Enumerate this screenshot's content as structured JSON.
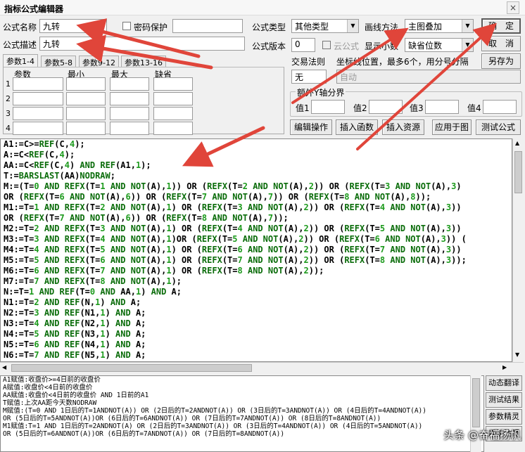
{
  "window": {
    "title": "指标公式编辑器",
    "close": "×"
  },
  "form": {
    "name_label": "公式名称",
    "name_value": "九转",
    "password_label": "密码保护",
    "desc_label": "公式描述",
    "desc_value": "九转",
    "type_label": "公式类型",
    "type_value": "其他类型",
    "draw_label": "画线方法",
    "draw_value": "主图叠加",
    "version_label": "公式版本",
    "version_value": "0",
    "cloud_label": "云公式",
    "decimal_label": "显示小数",
    "decimal_value": "缺省位数"
  },
  "buttons": {
    "ok": "确　定",
    "cancel": "取　消",
    "save_as": "另存为",
    "edit": "编辑操作",
    "insert_func": "插入函数",
    "insert_res": "插入资源",
    "apply": "应用于图",
    "test": "测试公式"
  },
  "params": {
    "tabs": [
      "参数1-4",
      "参数5-8",
      "参数9-12",
      "参数13-16"
    ],
    "headers": [
      "参数",
      "最小",
      "最大",
      "缺省"
    ],
    "rows": [
      "1",
      "2",
      "3",
      "4"
    ]
  },
  "trade": {
    "rule_label": "交易法则",
    "rule_value": "无",
    "coord_label": "坐标线位置，最多6个，用分号分隔",
    "coord_value": "自动"
  },
  "extra_y": {
    "title": "额外Y轴分界",
    "labels": [
      "值1",
      "值2",
      "值3",
      "值4"
    ]
  },
  "code_lines": [
    [
      [
        "t",
        "A1:=C>="
      ],
      [
        "k",
        "REF"
      ],
      [
        "t",
        "(C,"
      ],
      [
        "n",
        "4"
      ],
      [
        "t",
        ");"
      ]
    ],
    [
      [
        "t",
        "A:=C<"
      ],
      [
        "k",
        "REF"
      ],
      [
        "t",
        "(C,"
      ],
      [
        "n",
        "4"
      ],
      [
        "t",
        ");"
      ]
    ],
    [
      [
        "t",
        "AA:=C<"
      ],
      [
        "k",
        "REF"
      ],
      [
        "t",
        "(C,"
      ],
      [
        "n",
        "4"
      ],
      [
        "t",
        ") "
      ],
      [
        "k",
        "AND"
      ],
      [
        "t",
        " "
      ],
      [
        "k",
        "REF"
      ],
      [
        "t",
        "(A1,"
      ],
      [
        "n",
        "1"
      ],
      [
        "t",
        ");"
      ]
    ],
    [
      [
        "t",
        "T:="
      ],
      [
        "k",
        "BARSLAST"
      ],
      [
        "t",
        "(AA)"
      ],
      [
        "k",
        "NODRAW"
      ],
      [
        "t",
        ";"
      ]
    ],
    [
      [
        "t",
        "M:=(T="
      ],
      [
        "n",
        "0"
      ],
      [
        "t",
        " "
      ],
      [
        "k",
        "AND"
      ],
      [
        "t",
        " "
      ],
      [
        "k",
        "REFX"
      ],
      [
        "t",
        "(T="
      ],
      [
        "n",
        "1"
      ],
      [
        "t",
        " "
      ],
      [
        "k",
        "AND"
      ],
      [
        "t",
        " "
      ],
      [
        "k",
        "NOT"
      ],
      [
        "t",
        "(A),"
      ],
      [
        "n",
        "1"
      ],
      [
        "t",
        ")) OR ("
      ],
      [
        "k",
        "REFX"
      ],
      [
        "t",
        "(T="
      ],
      [
        "n",
        "2"
      ],
      [
        "t",
        " "
      ],
      [
        "k",
        "AND"
      ],
      [
        "t",
        " "
      ],
      [
        "k",
        "NOT"
      ],
      [
        "t",
        "(A),"
      ],
      [
        "n",
        "2"
      ],
      [
        "t",
        ")) OR ("
      ],
      [
        "k",
        "REFX"
      ],
      [
        "t",
        "(T="
      ],
      [
        "n",
        "3"
      ],
      [
        "t",
        " "
      ],
      [
        "k",
        "AND"
      ],
      [
        "t",
        " "
      ],
      [
        "k",
        "NOT"
      ],
      [
        "t",
        "(A),"
      ],
      [
        "n",
        "3"
      ],
      [
        "t",
        ")"
      ]
    ],
    [
      [
        "t",
        "OR ("
      ],
      [
        "k",
        "REFX"
      ],
      [
        "t",
        "(T="
      ],
      [
        "n",
        "6"
      ],
      [
        "t",
        " "
      ],
      [
        "k",
        "AND"
      ],
      [
        "t",
        " "
      ],
      [
        "k",
        "NOT"
      ],
      [
        "t",
        "(A),"
      ],
      [
        "n",
        "6"
      ],
      [
        "t",
        ")) OR ("
      ],
      [
        "k",
        "REFX"
      ],
      [
        "t",
        "(T="
      ],
      [
        "n",
        "7"
      ],
      [
        "t",
        " "
      ],
      [
        "k",
        "AND"
      ],
      [
        "t",
        " "
      ],
      [
        "k",
        "NOT"
      ],
      [
        "t",
        "(A),"
      ],
      [
        "n",
        "7"
      ],
      [
        "t",
        ")) OR ("
      ],
      [
        "k",
        "REFX"
      ],
      [
        "t",
        "(T="
      ],
      [
        "n",
        "8"
      ],
      [
        "t",
        " "
      ],
      [
        "k",
        "AND"
      ],
      [
        "t",
        " "
      ],
      [
        "k",
        "NOT"
      ],
      [
        "t",
        "(A),"
      ],
      [
        "n",
        "8"
      ],
      [
        "t",
        "));"
      ]
    ],
    [
      [
        "t",
        "M1:=T="
      ],
      [
        "n",
        "1"
      ],
      [
        "t",
        " "
      ],
      [
        "k",
        "AND"
      ],
      [
        "t",
        " "
      ],
      [
        "k",
        "REFX"
      ],
      [
        "t",
        "(T="
      ],
      [
        "n",
        "2"
      ],
      [
        "t",
        " "
      ],
      [
        "k",
        "AND"
      ],
      [
        "t",
        " "
      ],
      [
        "k",
        "NOT"
      ],
      [
        "t",
        "(A),"
      ],
      [
        "n",
        "1"
      ],
      [
        "t",
        ") OR ("
      ],
      [
        "k",
        "REFX"
      ],
      [
        "t",
        "(T="
      ],
      [
        "n",
        "3"
      ],
      [
        "t",
        " "
      ],
      [
        "k",
        "AND"
      ],
      [
        "t",
        " "
      ],
      [
        "k",
        "NOT"
      ],
      [
        "t",
        "(A),"
      ],
      [
        "n",
        "2"
      ],
      [
        "t",
        ")) OR ("
      ],
      [
        "k",
        "REFX"
      ],
      [
        "t",
        "(T="
      ],
      [
        "n",
        "4"
      ],
      [
        "t",
        " "
      ],
      [
        "k",
        "AND"
      ],
      [
        "t",
        " "
      ],
      [
        "k",
        "NOT"
      ],
      [
        "t",
        "(A),"
      ],
      [
        "n",
        "3"
      ],
      [
        "t",
        "))"
      ]
    ],
    [
      [
        "t",
        "OR ("
      ],
      [
        "k",
        "REFX"
      ],
      [
        "t",
        "(T="
      ],
      [
        "n",
        "7"
      ],
      [
        "t",
        " "
      ],
      [
        "k",
        "AND"
      ],
      [
        "t",
        " "
      ],
      [
        "k",
        "NOT"
      ],
      [
        "t",
        "(A),"
      ],
      [
        "n",
        "6"
      ],
      [
        "t",
        ")) OR ("
      ],
      [
        "k",
        "REFX"
      ],
      [
        "t",
        "(T="
      ],
      [
        "n",
        "8"
      ],
      [
        "t",
        " "
      ],
      [
        "k",
        "AND"
      ],
      [
        "t",
        " "
      ],
      [
        "k",
        "NOT"
      ],
      [
        "t",
        "(A),"
      ],
      [
        "n",
        "7"
      ],
      [
        "t",
        "));"
      ]
    ],
    [
      [
        "t",
        "M2:=T="
      ],
      [
        "n",
        "2"
      ],
      [
        "t",
        " "
      ],
      [
        "k",
        "AND"
      ],
      [
        "t",
        " "
      ],
      [
        "k",
        "REFX"
      ],
      [
        "t",
        "(T="
      ],
      [
        "n",
        "3"
      ],
      [
        "t",
        " "
      ],
      [
        "k",
        "AND"
      ],
      [
        "t",
        " "
      ],
      [
        "k",
        "NOT"
      ],
      [
        "t",
        "(A),"
      ],
      [
        "n",
        "1"
      ],
      [
        "t",
        ") OR ("
      ],
      [
        "k",
        "REFX"
      ],
      [
        "t",
        "(T="
      ],
      [
        "n",
        "4"
      ],
      [
        "t",
        " "
      ],
      [
        "k",
        "AND"
      ],
      [
        "t",
        " "
      ],
      [
        "k",
        "NOT"
      ],
      [
        "t",
        "(A),"
      ],
      [
        "n",
        "2"
      ],
      [
        "t",
        ")) OR ("
      ],
      [
        "k",
        "REFX"
      ],
      [
        "t",
        "(T="
      ],
      [
        "n",
        "5"
      ],
      [
        "t",
        " "
      ],
      [
        "k",
        "AND"
      ],
      [
        "t",
        " "
      ],
      [
        "k",
        "NOT"
      ],
      [
        "t",
        "(A),"
      ],
      [
        "n",
        "3"
      ],
      [
        "t",
        "))"
      ]
    ],
    [
      [
        "t",
        "M3:=T="
      ],
      [
        "n",
        "3"
      ],
      [
        "t",
        " "
      ],
      [
        "k",
        "AND"
      ],
      [
        "t",
        " "
      ],
      [
        "k",
        "REFX"
      ],
      [
        "t",
        "(T="
      ],
      [
        "n",
        "4"
      ],
      [
        "t",
        " "
      ],
      [
        "k",
        "AND"
      ],
      [
        "t",
        " "
      ],
      [
        "k",
        "NOT"
      ],
      [
        "t",
        "(A),"
      ],
      [
        "n",
        "1"
      ],
      [
        "t",
        ")OR ("
      ],
      [
        "k",
        "REFX"
      ],
      [
        "t",
        "(T="
      ],
      [
        "n",
        "5"
      ],
      [
        "t",
        " "
      ],
      [
        "k",
        "AND"
      ],
      [
        "t",
        " "
      ],
      [
        "k",
        "NOT"
      ],
      [
        "t",
        "(A),"
      ],
      [
        "n",
        "2"
      ],
      [
        "t",
        ")) OR ("
      ],
      [
        "k",
        "REFX"
      ],
      [
        "t",
        "(T="
      ],
      [
        "n",
        "6"
      ],
      [
        "t",
        " "
      ],
      [
        "k",
        "AND"
      ],
      [
        "t",
        " "
      ],
      [
        "k",
        "NOT"
      ],
      [
        "t",
        "(A),"
      ],
      [
        "n",
        "3"
      ],
      [
        "t",
        ")) ("
      ]
    ],
    [
      [
        "t",
        "M4:=T="
      ],
      [
        "n",
        "4"
      ],
      [
        "t",
        " "
      ],
      [
        "k",
        "AND"
      ],
      [
        "t",
        " "
      ],
      [
        "k",
        "REFX"
      ],
      [
        "t",
        "(T="
      ],
      [
        "n",
        "5"
      ],
      [
        "t",
        " "
      ],
      [
        "k",
        "AND"
      ],
      [
        "t",
        " "
      ],
      [
        "k",
        "NOT"
      ],
      [
        "t",
        "(A),"
      ],
      [
        "n",
        "1"
      ],
      [
        "t",
        ") OR ("
      ],
      [
        "k",
        "REFX"
      ],
      [
        "t",
        "(T="
      ],
      [
        "n",
        "6"
      ],
      [
        "t",
        " "
      ],
      [
        "k",
        "AND"
      ],
      [
        "t",
        " "
      ],
      [
        "k",
        "NOT"
      ],
      [
        "t",
        "(A),"
      ],
      [
        "n",
        "2"
      ],
      [
        "t",
        ")) OR ("
      ],
      [
        "k",
        "REFX"
      ],
      [
        "t",
        "(T="
      ],
      [
        "n",
        "7"
      ],
      [
        "t",
        " "
      ],
      [
        "k",
        "AND"
      ],
      [
        "t",
        " "
      ],
      [
        "k",
        "NOT"
      ],
      [
        "t",
        "(A),"
      ],
      [
        "n",
        "3"
      ],
      [
        "t",
        "))"
      ]
    ],
    [
      [
        "t",
        "M5:=T="
      ],
      [
        "n",
        "5"
      ],
      [
        "t",
        " "
      ],
      [
        "k",
        "AND"
      ],
      [
        "t",
        " "
      ],
      [
        "k",
        "REFX"
      ],
      [
        "t",
        "(T="
      ],
      [
        "n",
        "6"
      ],
      [
        "t",
        " "
      ],
      [
        "k",
        "AND"
      ],
      [
        "t",
        " "
      ],
      [
        "k",
        "NOT"
      ],
      [
        "t",
        "(A),"
      ],
      [
        "n",
        "1"
      ],
      [
        "t",
        ") OR ("
      ],
      [
        "k",
        "REFX"
      ],
      [
        "t",
        "(T="
      ],
      [
        "n",
        "7"
      ],
      [
        "t",
        " "
      ],
      [
        "k",
        "AND"
      ],
      [
        "t",
        " "
      ],
      [
        "k",
        "NOT"
      ],
      [
        "t",
        "(A),"
      ],
      [
        "n",
        "2"
      ],
      [
        "t",
        ")) OR ("
      ],
      [
        "k",
        "REFX"
      ],
      [
        "t",
        "(T="
      ],
      [
        "n",
        "8"
      ],
      [
        "t",
        " "
      ],
      [
        "k",
        "AND"
      ],
      [
        "t",
        " "
      ],
      [
        "k",
        "NOT"
      ],
      [
        "t",
        "(A),"
      ],
      [
        "n",
        "3"
      ],
      [
        "t",
        "));"
      ]
    ],
    [
      [
        "t",
        "M6:=T="
      ],
      [
        "n",
        "6"
      ],
      [
        "t",
        " "
      ],
      [
        "k",
        "AND"
      ],
      [
        "t",
        " "
      ],
      [
        "k",
        "REFX"
      ],
      [
        "t",
        "(T="
      ],
      [
        "n",
        "7"
      ],
      [
        "t",
        " "
      ],
      [
        "k",
        "AND"
      ],
      [
        "t",
        " "
      ],
      [
        "k",
        "NOT"
      ],
      [
        "t",
        "(A),"
      ],
      [
        "n",
        "1"
      ],
      [
        "t",
        ") OR ("
      ],
      [
        "k",
        "REFX"
      ],
      [
        "t",
        "(T="
      ],
      [
        "n",
        "8"
      ],
      [
        "t",
        " "
      ],
      [
        "k",
        "AND"
      ],
      [
        "t",
        " "
      ],
      [
        "k",
        "NOT"
      ],
      [
        "t",
        "(A),"
      ],
      [
        "n",
        "2"
      ],
      [
        "t",
        "));"
      ]
    ],
    [
      [
        "t",
        "M7:=T="
      ],
      [
        "n",
        "7"
      ],
      [
        "t",
        " "
      ],
      [
        "k",
        "AND"
      ],
      [
        "t",
        " "
      ],
      [
        "k",
        "REFX"
      ],
      [
        "t",
        "(T="
      ],
      [
        "n",
        "8"
      ],
      [
        "t",
        " "
      ],
      [
        "k",
        "AND"
      ],
      [
        "t",
        " "
      ],
      [
        "k",
        "NOT"
      ],
      [
        "t",
        "(A),"
      ],
      [
        "n",
        "1"
      ],
      [
        "t",
        ");"
      ]
    ],
    [
      [
        "t",
        "N:=T="
      ],
      [
        "n",
        "1"
      ],
      [
        "t",
        " "
      ],
      [
        "k",
        "AND"
      ],
      [
        "t",
        " "
      ],
      [
        "k",
        "REF"
      ],
      [
        "t",
        "(T="
      ],
      [
        "n",
        "0"
      ],
      [
        "t",
        " "
      ],
      [
        "k",
        "AND"
      ],
      [
        "t",
        " AA,"
      ],
      [
        "n",
        "1"
      ],
      [
        "t",
        ") "
      ],
      [
        "k",
        "AND"
      ],
      [
        "t",
        " A;"
      ]
    ],
    [
      [
        "t",
        "N1:=T="
      ],
      [
        "n",
        "2"
      ],
      [
        "t",
        " "
      ],
      [
        "k",
        "AND"
      ],
      [
        "t",
        " "
      ],
      [
        "k",
        "REF"
      ],
      [
        "t",
        "(N,"
      ],
      [
        "n",
        "1"
      ],
      [
        "t",
        ") "
      ],
      [
        "k",
        "AND"
      ],
      [
        "t",
        " A;"
      ]
    ],
    [
      [
        "t",
        "N2:=T="
      ],
      [
        "n",
        "3"
      ],
      [
        "t",
        " "
      ],
      [
        "k",
        "AND"
      ],
      [
        "t",
        " "
      ],
      [
        "k",
        "REF"
      ],
      [
        "t",
        "(N1,"
      ],
      [
        "n",
        "1"
      ],
      [
        "t",
        ") "
      ],
      [
        "k",
        "AND"
      ],
      [
        "t",
        " A;"
      ]
    ],
    [
      [
        "t",
        "N3:=T="
      ],
      [
        "n",
        "4"
      ],
      [
        "t",
        " "
      ],
      [
        "k",
        "AND"
      ],
      [
        "t",
        " "
      ],
      [
        "k",
        "REF"
      ],
      [
        "t",
        "(N2,"
      ],
      [
        "n",
        "1"
      ],
      [
        "t",
        ") "
      ],
      [
        "k",
        "AND"
      ],
      [
        "t",
        " A;"
      ]
    ],
    [
      [
        "t",
        "N4:=T="
      ],
      [
        "n",
        "5"
      ],
      [
        "t",
        " "
      ],
      [
        "k",
        "AND"
      ],
      [
        "t",
        " "
      ],
      [
        "k",
        "REF"
      ],
      [
        "t",
        "(N3,"
      ],
      [
        "n",
        "1"
      ],
      [
        "t",
        ") "
      ],
      [
        "k",
        "AND"
      ],
      [
        "t",
        " A;"
      ]
    ],
    [
      [
        "t",
        "N5:=T="
      ],
      [
        "n",
        "6"
      ],
      [
        "t",
        " "
      ],
      [
        "k",
        "AND"
      ],
      [
        "t",
        " "
      ],
      [
        "k",
        "REF"
      ],
      [
        "t",
        "(N4,"
      ],
      [
        "n",
        "1"
      ],
      [
        "t",
        ") "
      ],
      [
        "k",
        "AND"
      ],
      [
        "t",
        " A;"
      ]
    ],
    [
      [
        "t",
        "N6:=T="
      ],
      [
        "n",
        "7"
      ],
      [
        "t",
        " "
      ],
      [
        "k",
        "AND"
      ],
      [
        "t",
        " "
      ],
      [
        "k",
        "REF"
      ],
      [
        "t",
        "(N5,"
      ],
      [
        "n",
        "1"
      ],
      [
        "t",
        ") "
      ],
      [
        "k",
        "AND"
      ],
      [
        "t",
        " A;"
      ]
    ]
  ],
  "desc_lines": [
    "A1赋值:收盘价>=4日前的收盘价",
    "A赋值:收盘价<4日前的收盘价",
    "AA赋值:收盘价<4日前的收盘价 AND 1日前的A1",
    "T赋值:上次AA距今天数NODRAW",
    "M赋值:(T=0 AND 1日后的T=1ANDNOT(A)) OR (2日后的T=2ANDNOT(A)) OR (3日后的T=3ANDNOT(A)) OR (4日后的T=4ANDNOT(A))",
    "OR (5日后的T=5ANDNOT(A))OR (6日后的T=6ANDNOT(A)) OR (7日后的T=7ANDNOT(A)) OR (8日后的T=8ANDNOT(A))",
    "M1赋值:T=1 AND 1日后的T=2ANDNOT(A) OR (2日后的T=3ANDNOT(A)) OR (3日后的T=4ANDNOT(A)) OR (4日后的T=5ANDNOT(A))",
    "OR (5日后的T=6ANDNOT(A))OR (6日后的T=7ANDNOT(A)) OR (7日后的T=8ANDNOT(A))"
  ],
  "side_buttons": [
    "动态翻译",
    "测试结果",
    "参数精灵",
    "用法注释"
  ],
  "watermark": "头条 @奋福扬帆",
  "colors": {
    "keyword": "#0a6c0a",
    "number": "#1d9a1d",
    "arrow": "#e0453a"
  }
}
